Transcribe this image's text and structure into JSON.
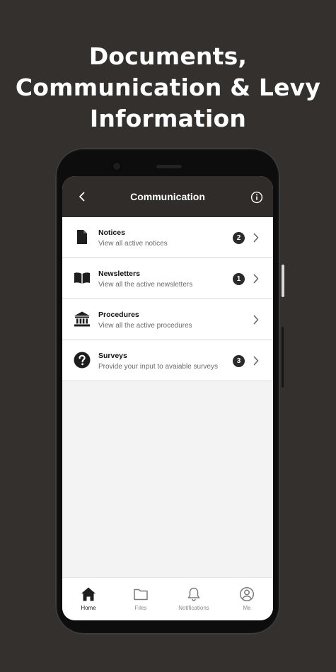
{
  "headline": [
    "Documents,",
    "Communication & Levy",
    "Information"
  ],
  "appbar": {
    "title": "Communication",
    "back_icon": "chevron-left-icon",
    "info_icon": "info-icon"
  },
  "items": [
    {
      "title": "Notices",
      "subtitle": "View all active notices",
      "badge": "2",
      "icon": "document-icon"
    },
    {
      "title": "Newsletters",
      "subtitle": "View all the active newsletters",
      "badge": "1",
      "icon": "open-book-icon"
    },
    {
      "title": "Procedures",
      "subtitle": "View all the active procedures",
      "badge": "",
      "icon": "bank-building-icon"
    },
    {
      "title": "Surveys",
      "subtitle": "Provide your input to avaiable surveys",
      "badge": "3",
      "icon": "question-circle-icon"
    }
  ],
  "nav": [
    {
      "label": "Home",
      "icon": "home-icon",
      "active": true
    },
    {
      "label": "Files",
      "icon": "folder-icon",
      "active": false
    },
    {
      "label": "Notifications",
      "icon": "bell-icon",
      "active": false
    },
    {
      "label": "Me",
      "icon": "user-circle-icon",
      "active": false
    }
  ],
  "colors": {
    "background": "#33302e",
    "appbar": "#2f2c2a",
    "badge": "#2a2a2a",
    "screen": "#f3f3f3"
  }
}
